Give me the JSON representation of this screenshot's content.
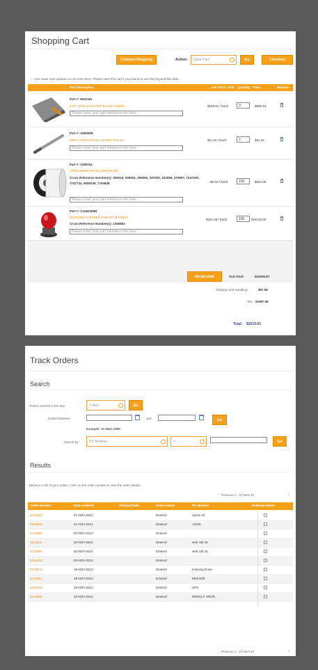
{
  "cart": {
    "title": "Shopping Cart",
    "continue_label": "Continue Shopping",
    "action_label": "Action:",
    "action_value": "Save Cart",
    "go_label": "Go",
    "checkout_label": "Checkout",
    "notice": "Your Save Cart updates on 24-JUN-2014. Please save this cart if you intend to use this beyond this date.",
    "columns": {
      "desc": "Part Description",
      "unit": "Unit Price / Unit",
      "qty": "Quantity",
      "price": "Price",
      "remove": "Remove"
    },
    "items": [
      {
        "part": "Part #: 6041161",
        "name": "GYP HAND SCRAPER BLADE 150MM",
        "ref": "",
        "note_placeholder": "Please enter your part reference info here...",
        "unit": "$198.81 / Each",
        "qty": "3",
        "price": "$596.43"
      },
      {
        "part": "Part #: 1N83808",
        "name": "IMPACT DRIVER BIT 1/4 HEX PH2 50",
        "ref": "",
        "note_placeholder": "Please enter your part reference info here...",
        "unit": "$11.22 / Each",
        "qty": "2",
        "price": "$22.44"
      },
      {
        "part": "Part #: 3180191",
        "name": "STEEL WIRE SPOOL BORON 350",
        "ref": "Cross Reference Number(s): 306016, 306061, 306065, 307002, 322099, 376997, 7447100, 7747734, 9005239, 7754848",
        "note_placeholder": "Please enter your part reference info here...",
        "unit": "$5.63 / Each",
        "qty": "100",
        "price": "$563.00"
      },
      {
        "part": "Part #: C1062309R",
        "name": "ROTO BEACON RED PIER MT MAGNET",
        "ref": "Cross Reference Number(s): 1350852",
        "note_placeholder": "Please enter your part reference info here...",
        "unit": "$161.36 / Each",
        "qty": "100",
        "price": "$16136.00"
      }
    ],
    "recalculate_label": "Recalculate",
    "subtotal_label": "Sub-Total:",
    "subtotal": "$23256.87",
    "shipping_label": "Shipping and Handling:",
    "shipping": "$97.58",
    "tax_label": "Tax:",
    "tax": "$1987.68",
    "total_label": "Total:",
    "total": "$2519.03"
  },
  "track": {
    "title": "Track Orders",
    "search_title": "Search",
    "entered_label": "Orders entered in the last",
    "entered_value": "7 days",
    "go_label": "Go",
    "between_label": "Orders between",
    "and_label": "and",
    "example": "Example: 31-DEC-1999",
    "search_by_label": "Search By",
    "search_by_value": "PO Number",
    "operator_value": "=",
    "results_title": "Results",
    "results_note": "Below is a list of your orders. Click on the order number to view the order details.",
    "pager": "Previous 1 - 10 Next 10",
    "columns": [
      "Order Number",
      "Date Ordered",
      "Shipped Date",
      "Order Status",
      "PO Number",
      "Relevant Notes"
    ],
    "orders": [
      {
        "num": "3213454",
        "date": "21-NOV-2014",
        "shipped": "",
        "status": "Entered",
        "po": "Jamie 43"
      },
      {
        "num": "3199456",
        "date": "21-NOV-2014",
        "shipped": "",
        "status": "Entered",
        "po": "12345"
      },
      {
        "num": "3214880",
        "date": "20-NOV-2014",
        "shipped": "",
        "status": "Entered",
        "po": ""
      },
      {
        "num": "3213644",
        "date": "20-NOV-2014",
        "shipped": "",
        "status": "Entered",
        "po": "web call 43"
      },
      {
        "num": "3213460",
        "date": "20-NOV-2014",
        "shipped": "",
        "status": "Entered",
        "po": "web call 43"
      },
      {
        "num": "3213433",
        "date": "20-NOV-2014",
        "shipped": "",
        "status": "Entered",
        "po": ""
      },
      {
        "num": "3212874",
        "date": "19-NOV-2014",
        "shipped": "",
        "status": "Entered",
        "po": "Canning Down"
      },
      {
        "num": "3212851",
        "date": "19-NOV-2014",
        "shipped": "",
        "status": "Entered",
        "po": "Web Edit"
      },
      {
        "num": "3212842",
        "date": "19-NOV-2014",
        "shipped": "",
        "status": "Entered",
        "po": "UPS"
      },
      {
        "num": "3212888",
        "date": "19-NOV-2014",
        "shipped": "",
        "status": "Entered",
        "po": "WEEKLY ORDR"
      }
    ]
  },
  "colors": {
    "accent": "#f7a11a",
    "frame": "#5a5a5a",
    "link": "#f08c00"
  }
}
